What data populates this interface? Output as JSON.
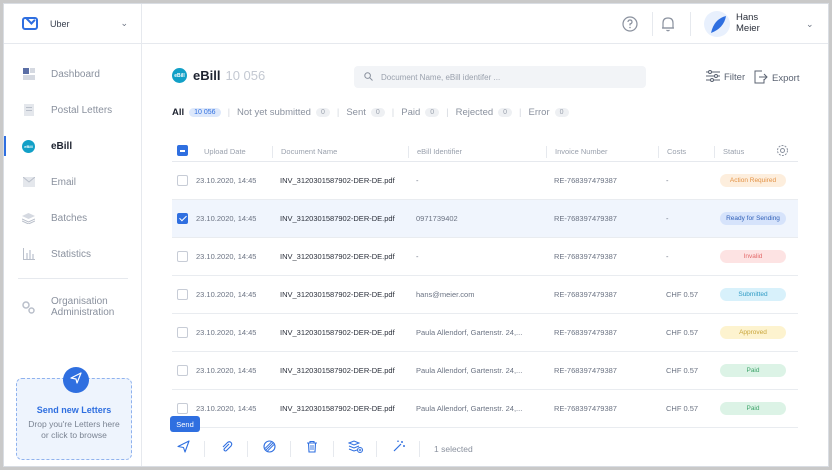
{
  "org": {
    "name": "Uber"
  },
  "colors": {
    "accent": "#2f6fe0",
    "ebill_badge": "#12a0c7"
  },
  "sidebar": {
    "items": [
      {
        "label": "Dashboard",
        "icon": "dashboard-icon"
      },
      {
        "label": "Postal Letters",
        "icon": "postal-letters-icon"
      },
      {
        "label": "eBill",
        "icon": "ebill-icon",
        "active": true
      },
      {
        "label": "Email",
        "icon": "email-icon"
      },
      {
        "label": "Batches",
        "icon": "batches-icon"
      },
      {
        "label": "Statistics",
        "icon": "statistics-icon"
      }
    ],
    "admin_label_line1": "Organisation",
    "admin_label_line2": "Administration",
    "send_card": {
      "title": "Send new Letters",
      "subtitle_line1": "Drop you're Letters here",
      "subtitle_line2": "or click to browse"
    }
  },
  "topbar": {
    "user_first": "Hans",
    "user_last": "Meier"
  },
  "page": {
    "badge_text": "eBill",
    "title": "eBill",
    "count": "10 056",
    "search_placeholder": "Document Name, eBill identifer ...",
    "filter_label": "Filter",
    "export_label": "Export"
  },
  "filters": [
    {
      "label": "All",
      "count": "10 056",
      "active": true
    },
    {
      "label": "Not yet submitted",
      "count": "0"
    },
    {
      "label": "Sent",
      "count": "0"
    },
    {
      "label": "Paid",
      "count": "0"
    },
    {
      "label": "Rejected",
      "count": "0"
    },
    {
      "label": "Error",
      "count": "0"
    }
  ],
  "table": {
    "columns": [
      "Upload Date",
      "Document Name",
      "eBill Identifier",
      "Invoice Number",
      "Costs",
      "Status"
    ],
    "rows": [
      {
        "date": "23.10.2020, 14:45",
        "doc": "INV_3120301587902-DER-DE.pdf",
        "identifier": "-",
        "invoice": "RE-768397479387",
        "costs": "-",
        "status": "Action Required",
        "status_bg": "#fdeedd",
        "status_fg": "#e39245",
        "checked": false
      },
      {
        "date": "23.10.2020, 14:45",
        "doc": "INV_3120301587902-DER-DE.pdf",
        "identifier": "0971739402",
        "invoice": "RE-768397479387",
        "costs": "-",
        "status": "Ready for Sending",
        "status_bg": "#d6e3fb",
        "status_fg": "#2f5fb8",
        "checked": true
      },
      {
        "date": "23.10.2020, 14:45",
        "doc": "INV_3120301587902-DER-DE.pdf",
        "identifier": "-",
        "invoice": "RE-768397479387",
        "costs": "-",
        "status": "Invalid",
        "status_bg": "#fde3e3",
        "status_fg": "#e36a6a",
        "checked": false
      },
      {
        "date": "23.10.2020, 14:45",
        "doc": "INV_3120301587902-DER-DE.pdf",
        "identifier": "hans@meier.com",
        "invoice": "RE-768397479387",
        "costs": "CHF 0.57",
        "status": "Submitted",
        "status_bg": "#d8f1fb",
        "status_fg": "#2f9bc4",
        "checked": false
      },
      {
        "date": "23.10.2020, 14:45",
        "doc": "INV_3120301587902-DER-DE.pdf",
        "identifier": "Paula Allendorf, Gartenstr. 24,...",
        "invoice": "RE-768397479387",
        "costs": "CHF 0.57",
        "status": "Approved",
        "status_bg": "#fdf3cf",
        "status_fg": "#c8a53a",
        "checked": false
      },
      {
        "date": "23.10.2020, 14:45",
        "doc": "INV_3120301587902-DER-DE.pdf",
        "identifier": "Paula Allendorf, Gartenstr. 24,...",
        "invoice": "RE-768397479387",
        "costs": "CHF 0.57",
        "status": "Paid",
        "status_bg": "#dcf3e6",
        "status_fg": "#3fa46b",
        "checked": false
      },
      {
        "date": "23.10.2020, 14:45",
        "doc": "INV_3120301587902-DER-DE.pdf",
        "identifier": "Paula Allendorf, Gartenstr. 24,...",
        "invoice": "RE-768397479387",
        "costs": "CHF 0.57",
        "status": "Paid",
        "status_bg": "#dcf3e6",
        "status_fg": "#3fa46b",
        "checked": false
      }
    ]
  },
  "actionbar": {
    "send_tooltip": "Send",
    "selected_text": "1 selected"
  }
}
